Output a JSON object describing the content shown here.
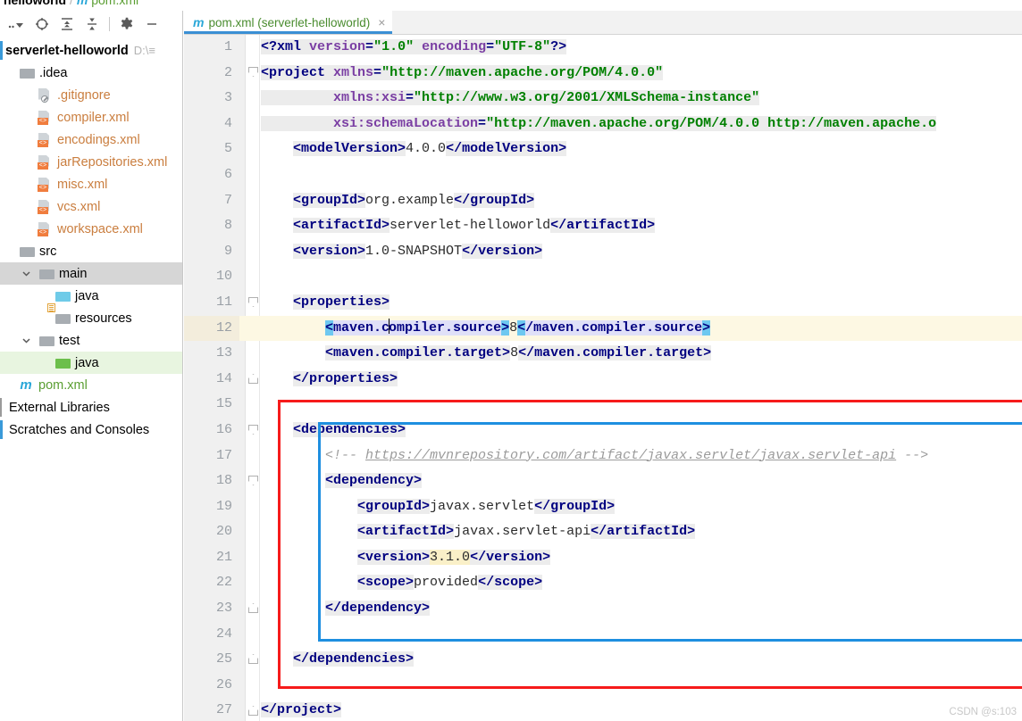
{
  "breadcrumb": {
    "project": "helloworld",
    "separator": "/",
    "m_icon": "m",
    "file": "pom.xml"
  },
  "toolbar": {
    "items": [
      {
        "name": "select-opened-file-dropdown",
        "glyph": "..▾"
      },
      {
        "name": "locate-target-icon",
        "glyph": "⊕"
      },
      {
        "name": "expand-all-icon",
        "glyph": "⩝"
      },
      {
        "name": "collapse-all-icon",
        "glyph": "⩞"
      },
      {
        "name": "settings-gear-icon",
        "glyph": "⚙"
      },
      {
        "name": "hide-panel-icon",
        "glyph": "—"
      }
    ]
  },
  "tree": {
    "root": {
      "label": "serverlet-helloworld",
      "path": "D:\\≡"
    },
    "items": [
      {
        "label": ".idea",
        "indent": 1,
        "icon": "folder-gray",
        "arrow": "",
        "kind": "folder"
      },
      {
        "label": ".gitignore",
        "indent": 2,
        "icon": "gitignore",
        "arrow": "",
        "kind": "xmlfile"
      },
      {
        "label": "compiler.xml",
        "indent": 2,
        "icon": "xml",
        "arrow": "",
        "kind": "xmlfile"
      },
      {
        "label": "encodings.xml",
        "indent": 2,
        "icon": "xml",
        "arrow": "",
        "kind": "xmlfile"
      },
      {
        "label": "jarRepositories.xml",
        "indent": 2,
        "icon": "xml",
        "arrow": "",
        "kind": "xmlfile"
      },
      {
        "label": "misc.xml",
        "indent": 2,
        "icon": "xml",
        "arrow": "",
        "kind": "xmlfile"
      },
      {
        "label": "vcs.xml",
        "indent": 2,
        "icon": "xml",
        "arrow": "",
        "kind": "xmlfile"
      },
      {
        "label": "workspace.xml",
        "indent": 2,
        "icon": "xml",
        "arrow": "",
        "kind": "xmlfile"
      },
      {
        "label": "src",
        "indent": 1,
        "icon": "folder-gray",
        "arrow": "",
        "kind": "folder"
      },
      {
        "label": "main",
        "indent": 1,
        "icon": "folder-gray",
        "arrow": "⌄",
        "kind": "folder",
        "state": "gray"
      },
      {
        "label": "java",
        "indent": 2,
        "icon": "folder-blue",
        "arrow": "",
        "kind": "folder"
      },
      {
        "label": "resources",
        "indent": 2,
        "icon": "folder-res",
        "arrow": "",
        "kind": "folder"
      },
      {
        "label": "test",
        "indent": 1,
        "icon": "folder-gray",
        "arrow": "⌄",
        "kind": "folder"
      },
      {
        "label": "java",
        "indent": 2,
        "icon": "folder-green",
        "arrow": "",
        "kind": "folder",
        "state": "green"
      },
      {
        "label": "pom.xml",
        "indent": 1,
        "icon": "maven",
        "arrow": "",
        "kind": "maven"
      },
      {
        "label": "External Libraries",
        "indent": 0,
        "icon": "none",
        "arrow": "",
        "kind": "plain"
      },
      {
        "label": "Scratches and Consoles",
        "indent": 0,
        "icon": "none",
        "arrow": "",
        "kind": "plain"
      }
    ]
  },
  "tab": {
    "m_icon": "m",
    "title": "pom.xml (serverlet-helloworld)",
    "close": "×"
  },
  "editor": {
    "current_line": 12,
    "line_numbers": [
      1,
      2,
      3,
      4,
      5,
      6,
      7,
      8,
      9,
      10,
      11,
      12,
      13,
      14,
      15,
      16,
      17,
      18,
      19,
      20,
      21,
      22,
      23,
      24,
      25,
      26,
      27
    ],
    "folds": [
      {
        "line": 2,
        "dir": "down"
      },
      {
        "line": 11,
        "dir": "down"
      },
      {
        "line": 14,
        "dir": "up"
      },
      {
        "line": 16,
        "dir": "down"
      },
      {
        "line": 18,
        "dir": "down"
      },
      {
        "line": 23,
        "dir": "up"
      },
      {
        "line": 25,
        "dir": "up"
      },
      {
        "line": 27,
        "dir": "up"
      }
    ],
    "code_lines": [
      "<?xml version=\"1.0\" encoding=\"UTF-8\"?>",
      "<project xmlns=\"http://maven.apache.org/POM/4.0.0\"",
      "         xmlns:xsi=\"http://www.w3.org/2001/XMLSchema-instance\"",
      "         xsi:schemaLocation=\"http://maven.apache.org/POM/4.0.0 http://maven.apache.o",
      "    <modelVersion>4.0.0</modelVersion>",
      "",
      "    <groupId>org.example</groupId>",
      "    <artifactId>serverlet-helloworld</artifactId>",
      "    <version>1.0-SNAPSHOT</version>",
      "",
      "    <properties>",
      "        <maven.compiler.source>8</maven.compiler.source>",
      "        <maven.compiler.target>8</maven.compiler.target>",
      "    </properties>",
      "",
      "    <dependencies>",
      "        <!-- https://mvnrepository.com/artifact/javax.servlet/javax.servlet-api -->",
      "        <dependency>",
      "            <groupId>javax.servlet</groupId>",
      "            <artifactId>javax.servlet-api</artifactId>",
      "            <version>3.1.0</version>",
      "            <scope>provided</scope>",
      "        </dependency>",
      "",
      "    </dependencies>",
      "",
      "</project>"
    ],
    "comment_url": "https://mvnrepository.com/artifact/javax.servlet/javax.servlet-api",
    "highlight_version": "3.1.0"
  },
  "annotations": {
    "red_box_label": "dependencies-block-highlight",
    "blue_box_label": "dependency-block-highlight",
    "red_color": "#f61b1b",
    "blue_color": "#1e8fe0"
  },
  "watermark": "CSDN @s:103"
}
